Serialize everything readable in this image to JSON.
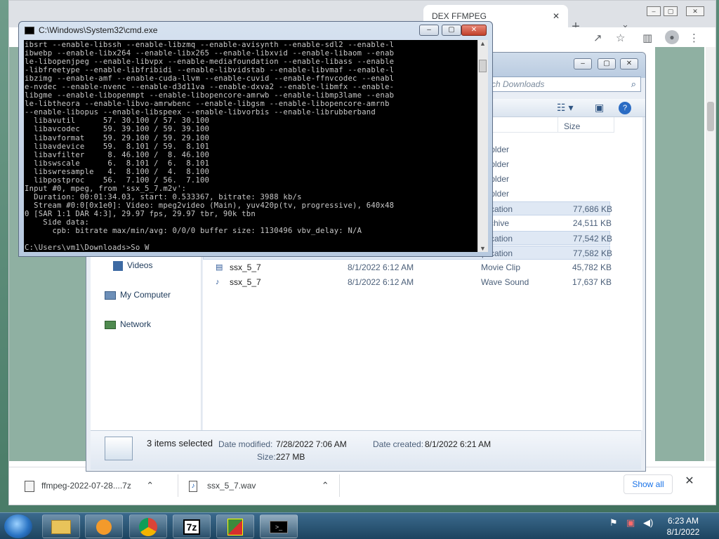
{
  "browser": {
    "tab_title": "DEX FFMPEG",
    "new_tab_symbol": "+",
    "downloads": [
      {
        "name": "ffmpeg-2022-07-28....7z",
        "icon": "archive-icon"
      },
      {
        "name": "ssx_5_7.wav",
        "icon": "audio-file-icon"
      }
    ],
    "show_all_label": "Show all",
    "close_symbol": "✕"
  },
  "explorer": {
    "search_placeholder": "ch Downloads",
    "columns": {
      "type": "pe",
      "size": "Size"
    },
    "nav": [
      {
        "label": "Videos",
        "icon": "videos-icon"
      },
      {
        "label": "My Computer",
        "icon": "computer-icon"
      },
      {
        "label": "Network",
        "icon": "network-icon"
      }
    ],
    "rows": [
      {
        "name": "",
        "date": "",
        "type": "e folder",
        "size": "",
        "selected": false
      },
      {
        "name": "",
        "date": "",
        "type": "e folder",
        "size": "",
        "selected": false
      },
      {
        "name": "",
        "date": "",
        "type": "e folder",
        "size": "",
        "selected": false
      },
      {
        "name": "",
        "date": "",
        "type": "e folder",
        "size": "",
        "selected": false
      },
      {
        "name": "",
        "date": "",
        "type": "plication",
        "size": "77,686 KB",
        "selected": true
      },
      {
        "name": "",
        "date": "",
        "type": "Archive",
        "size": "24,511 KB",
        "selected": false
      },
      {
        "name": "",
        "date": "",
        "type": "plication",
        "size": "77,542 KB",
        "selected": true
      },
      {
        "name": "",
        "date": "",
        "type": "plication",
        "size": "77,582 KB",
        "selected": true
      },
      {
        "name": "ssx_5_7",
        "date": "8/1/2022 6:12 AM",
        "type": "Movie Clip",
        "size": "45,782 KB",
        "selected": false
      },
      {
        "name": "ssx_5_7",
        "date": "8/1/2022 6:12 AM",
        "type": "Wave Sound",
        "size": "17,637 KB",
        "selected": false
      }
    ],
    "details": {
      "count": "3 items selected",
      "modified_label": "Date modified:",
      "modified_value": "7/28/2022 7:06 AM",
      "created_label": "Date created:",
      "created_value": "8/1/2022 6:21 AM",
      "size_label": "Size:",
      "size_value": "227 MB"
    }
  },
  "cmd": {
    "title": "C:\\Windows\\System32\\cmd.exe",
    "lines": [
      "ibsrt --enable-libssh --enable-libzmq --enable-avisynth --enable-sdl2 --enable-l",
      "ibwebp --enable-libx264 --enable-libx265 --enable-libxvid --enable-libaom --enab",
      "le-libopenjpeg --enable-libvpx --enable-mediafoundation --enable-libass --enable",
      "-libfreetype --enable-libfribidi --enable-libvidstab --enable-libvmaf --enable-l",
      "ibzimg --enable-amf --enable-cuda-llvm --enable-cuvid --enable-ffnvcodec --enabl",
      "e-nvdec --enable-nvenc --enable-d3d11va --enable-dxva2 --enable-libmfx --enable-",
      "libgme --enable-libopenmpt --enable-libopencore-amrwb --enable-libmp3lame --enab",
      "le-libtheora --enable-libvo-amrwbenc --enable-libgsm --enable-libopencore-amrnb",
      "--enable-libopus --enable-libspeex --enable-libvorbis --enable-librubberband",
      "  libavutil      57. 30.100 / 57. 30.100",
      "  libavcodec     59. 39.100 / 59. 39.100",
      "  libavformat    59. 29.100 / 59. 29.100",
      "  libavdevice    59.  8.101 / 59.  8.101",
      "  libavfilter     8. 46.100 /  8. 46.100",
      "  libswscale      6.  8.101 /  6.  8.101",
      "  libswresample   4.  8.100 /  4.  8.100",
      "  libpostproc    56.  7.100 / 56.  7.100",
      "Input #0, mpeg, from 'ssx_5_7.m2v':",
      "  Duration: 00:01:34.03, start: 0.533367, bitrate: 3988 kb/s",
      "  Stream #0:0[0x1e0]: Video: mpeg2video (Main), yuv420p(tv, progressive), 640x48",
      "0 [SAR 1:1 DAR 4:3], 29.97 fps, 29.97 tbr, 90k tbn",
      "    Side data:",
      "      cpb: bitrate max/min/avg: 0/0/0 buffer size: 1130496 vbv_delay: N/A",
      "",
      "C:\\Users\\vm1\\Downloads>So W"
    ]
  },
  "taskbar": {
    "time": "6:23 AM",
    "date": "8/1/2022",
    "apps": [
      "explorer-icon",
      "media-player-icon",
      "chrome-icon",
      "7zip-icon",
      "file-app-icon",
      "cmd-icon"
    ],
    "sevenzip_label": "7z"
  }
}
